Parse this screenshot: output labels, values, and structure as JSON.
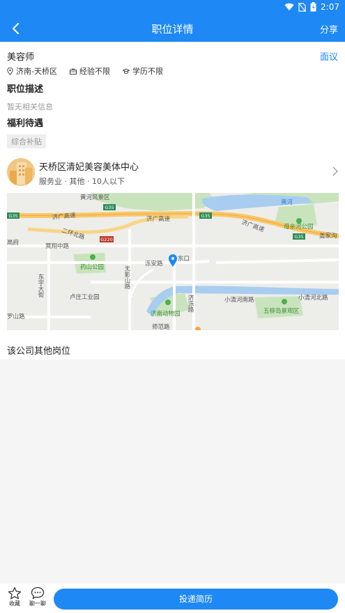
{
  "status_bar": {
    "time": "2:07"
  },
  "header": {
    "title": "职位详情",
    "share_label": "分享"
  },
  "job": {
    "title": "美容师",
    "salary": "面议",
    "location": "济南-天桥区",
    "experience": "经验不限",
    "education": "学历不限",
    "description_title": "职位描述",
    "description": "暂无相关信息",
    "benefits_title": "福利待遇",
    "benefits": [
      "综合补贴"
    ]
  },
  "company": {
    "name": "天桥区清妃美容美体中心",
    "meta": "服务业 · 其他 · 10人以下"
  },
  "map": {
    "labels": {
      "huanghe_park": "黄河风景区",
      "jiguang1": "济广高速",
      "jiguang2": "济广高速",
      "jiguang3": "济广高速",
      "erhuan": "二环北路",
      "qixiang": "蓂翔中路",
      "yaoshan": "药山公园",
      "wuying": "无影山路",
      "luoan": "泺安路",
      "dongkou": "东口",
      "luzhuang": "卢庄工业园",
      "jiluo": "济泺路",
      "dongyu": "东宇大街",
      "zoo": "济南动物园",
      "xiaoqinghe": "小清河南路",
      "xiaoqinghe_north": "小清河北路",
      "wuliudao": "五柳岛景观区",
      "muqinhe": "母亲河公园",
      "huanghe": "黄河",
      "gaijia": "盖家沟",
      "shigang": "师范路",
      "lifu": "鬲府",
      "yinshan": "罗山路",
      "g35a": "G35",
      "g35b": "G35",
      "g35c": "G35",
      "g35d": "G35",
      "g220": "G220"
    }
  },
  "other_jobs_title": "该公司其他岗位",
  "bottom": {
    "favorite_label": "收藏",
    "chat_label": "聊一聊",
    "submit_label": "投递简历"
  },
  "colors": {
    "brand": "#1e88f5"
  }
}
